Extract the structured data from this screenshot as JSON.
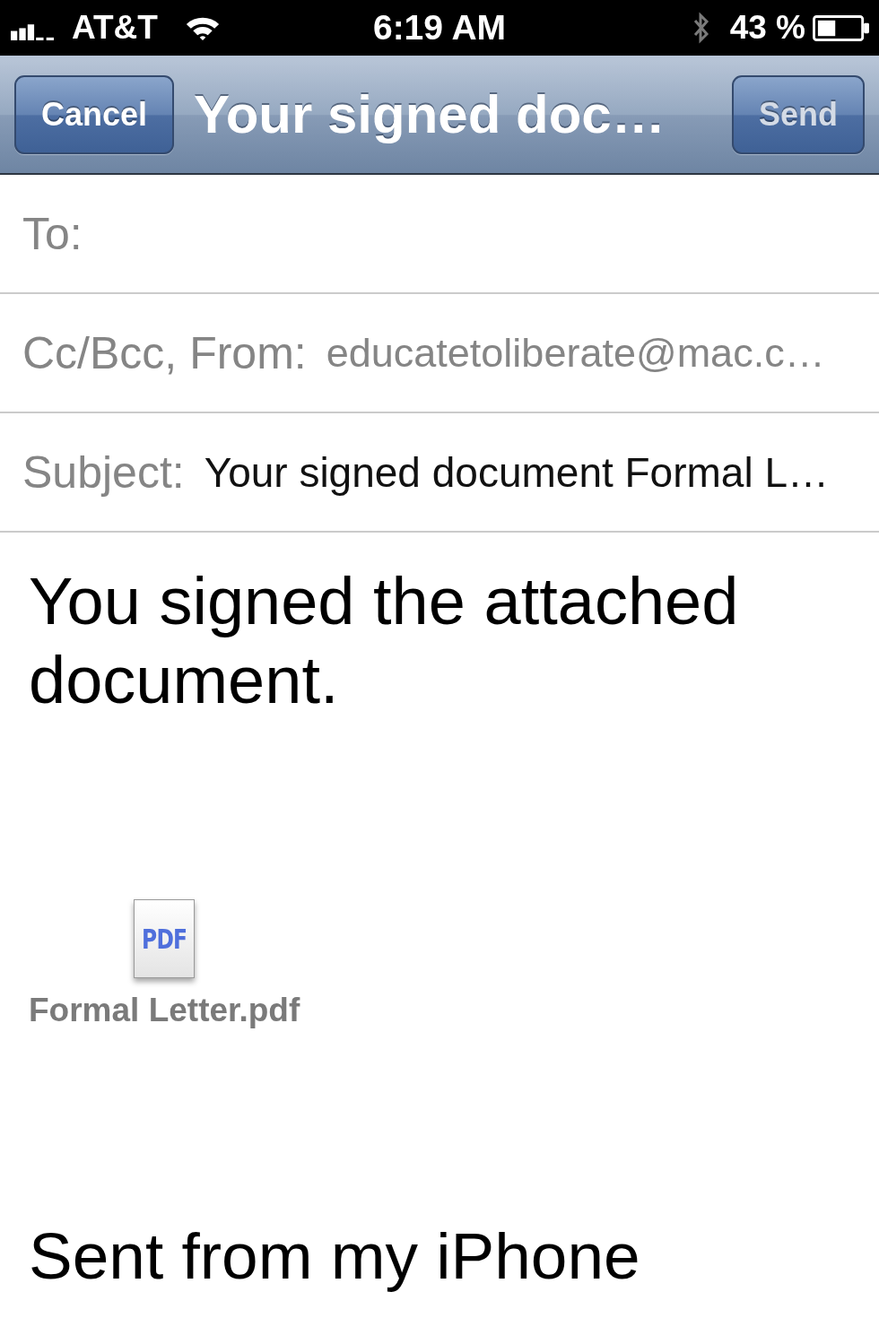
{
  "status_bar": {
    "carrier": "AT&T",
    "time": "6:19 AM",
    "battery_percent": "43 %"
  },
  "nav_bar": {
    "title": "Your signed doc…",
    "buttons": [
      {
        "label": "Cancel",
        "kind": "cancel",
        "disabled": false
      },
      {
        "label": "Send",
        "kind": "send",
        "disabled": true
      }
    ]
  },
  "fields": [
    {
      "kind": "recipient",
      "label": "To:"
    },
    {
      "kind": "sender",
      "label": "Cc/Bcc, From:",
      "value": "educatetoliberate@mac.c…"
    },
    {
      "kind": "subject",
      "label": "Subject:",
      "value": "Your signed document Formal L…"
    }
  ],
  "body": {
    "message": "You signed the attached document.",
    "attachment": {
      "icon_label": "PDF",
      "filename": "Formal Letter.pdf"
    },
    "signature": "Sent from my iPhone"
  }
}
